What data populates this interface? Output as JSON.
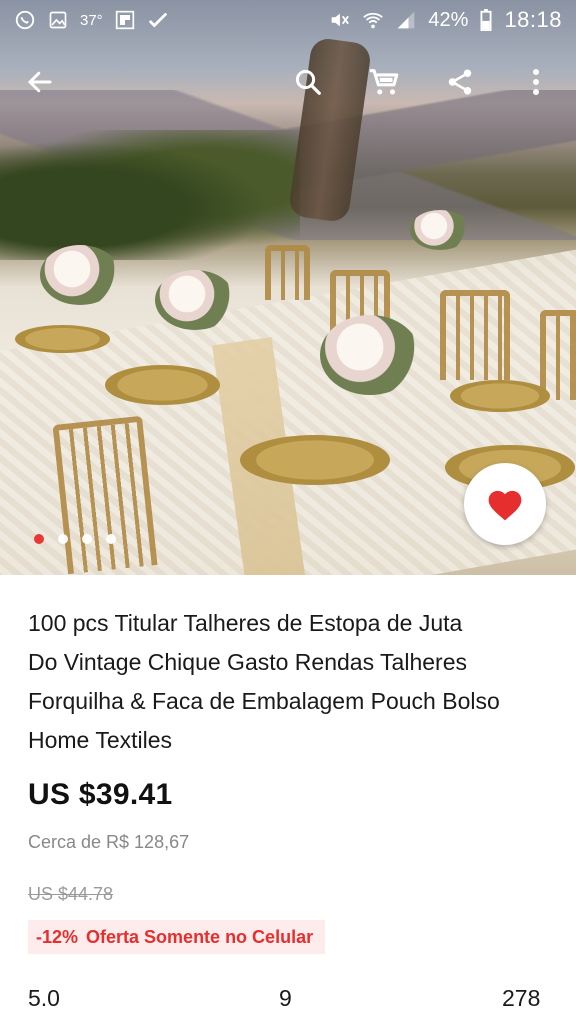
{
  "status_bar": {
    "temperature": "37°",
    "battery": "42%",
    "time": "18:18",
    "icons": [
      "whatsapp-icon",
      "gallery-icon",
      "temperature-icon",
      "flipboard-icon",
      "check-icon",
      "mute-icon",
      "wifi-icon",
      "signal-icon",
      "battery-icon"
    ]
  },
  "toolbar": {
    "icons": [
      "back-arrow-icon",
      "search-icon",
      "cart-icon",
      "share-icon",
      "more-vert-icon"
    ]
  },
  "gallery": {
    "image_count": 4,
    "active_index": 0
  },
  "product": {
    "title_lines": [
      "100 pcs Titular Talheres de Estopa de Juta",
      "Do Vintage Chique Gasto Rendas Talheres",
      "Forquilha & Faca de Embalagem Pouch Bolso",
      "Home Textiles"
    ],
    "price": "US $39.41",
    "approx_price": "Cerca de R$ 128,67",
    "original_price": "US $44.78",
    "promo": {
      "discount": "-12%",
      "label": "Oferta Somente no Celular"
    }
  },
  "stats": {
    "rating": "5.0",
    "reviews": "9",
    "orders": "278"
  },
  "colors": {
    "accent": "#e62e2e",
    "promo_bg": "#fdeceb",
    "text": "#1a1a1a",
    "muted": "#888888"
  }
}
